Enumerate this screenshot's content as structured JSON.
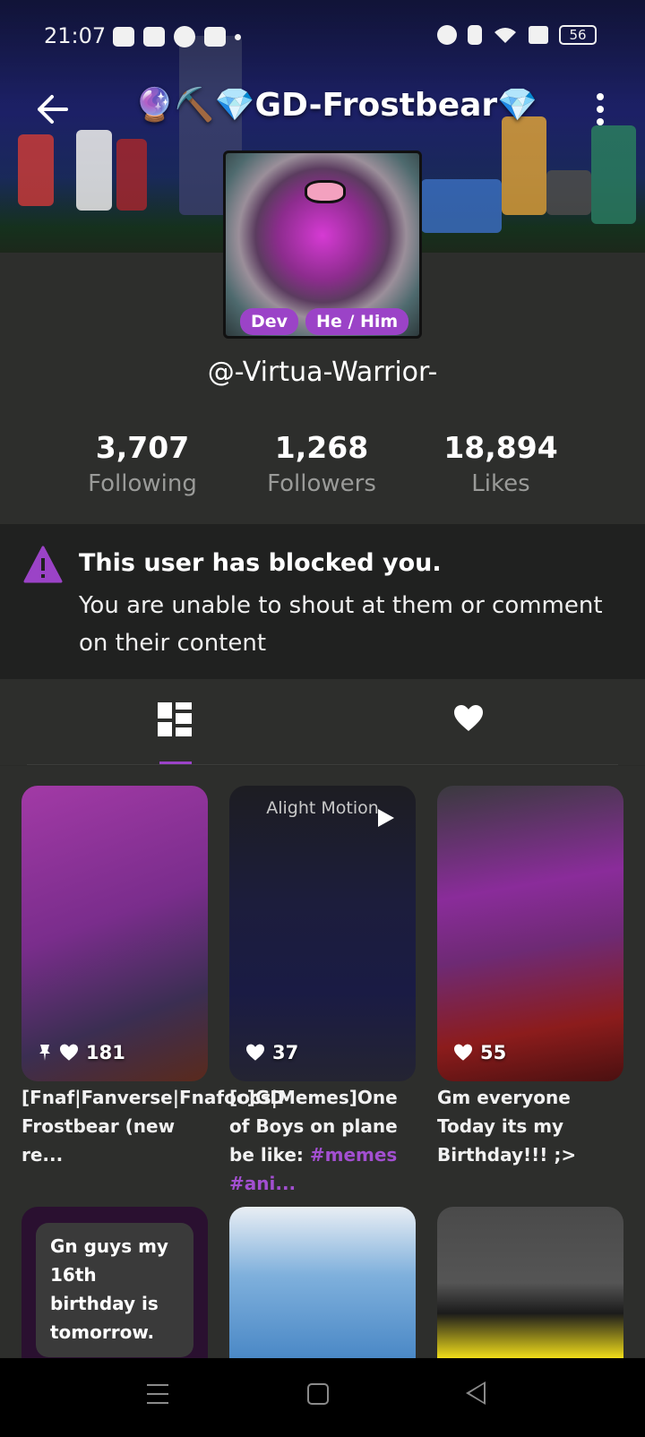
{
  "status_bar": {
    "time": "21:07",
    "battery": "56"
  },
  "header": {
    "title": "🔮⛏️💎GD-Frostbear💎"
  },
  "profile": {
    "badges": [
      "Dev",
      "He / Him"
    ],
    "username": "@-Virtua-Warrior-",
    "stats": [
      {
        "value": "3,707",
        "label": "Following"
      },
      {
        "value": "1,268",
        "label": "Followers"
      },
      {
        "value": "18,894",
        "label": "Likes"
      }
    ]
  },
  "notice": {
    "title": "This user has blocked you.",
    "text": "You are unable to shout at them or comment on their content"
  },
  "posts": [
    {
      "likes": "181",
      "pinned": true,
      "caption_plain": "[Fnaf|Fanverse|Fnafoc]GD Frostbear (new re...",
      "caption_tags": ""
    },
    {
      "likes": "37",
      "watermark": "Alight Motion",
      "caption_plain": "[ocs|Memes]One of Boys on plane be like: ",
      "caption_tags": "#memes #ani..."
    },
    {
      "likes": "55",
      "caption_plain": "Gm everyone Today its my Birthday!!! ;>",
      "caption_tags": ""
    }
  ],
  "posts_row2": [
    {
      "text": "Gn guys my 16th birthday is tomorrow."
    },
    {
      "text": ""
    },
    {
      "text": ""
    }
  ],
  "colors": {
    "accent": "#9b43c7",
    "background": "#2d2e2c",
    "notice_bg": "#202120"
  }
}
